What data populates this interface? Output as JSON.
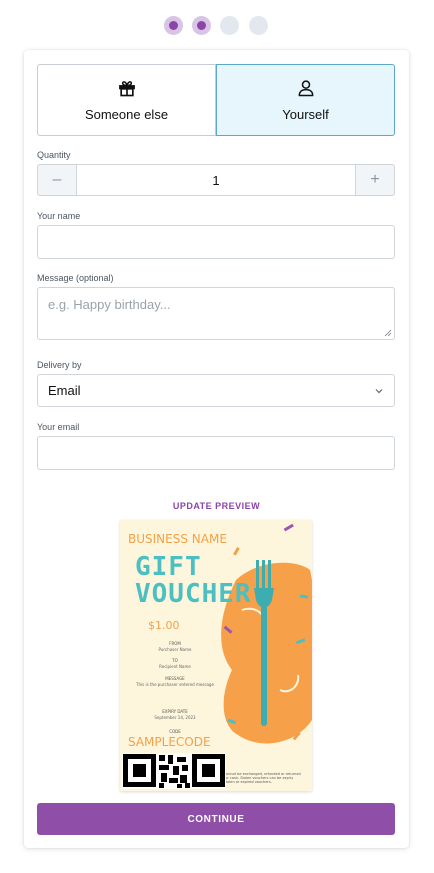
{
  "steps": [
    {
      "state": "done",
      "icon": "step-dot"
    },
    {
      "state": "done",
      "icon": "step-dot"
    },
    {
      "state": "pending",
      "icon": "step-dot"
    },
    {
      "state": "pending",
      "icon": "step-dot"
    }
  ],
  "recipient": {
    "someone_else": {
      "label": "Someone else",
      "icon": "gift-icon",
      "selected": false
    },
    "yourself": {
      "label": "Yourself",
      "icon": "user-icon",
      "selected": true
    }
  },
  "quantity": {
    "label": "Quantity",
    "value": "1",
    "decrement_icon": "minus-icon",
    "increment_icon": "plus-icon"
  },
  "your_name": {
    "label": "Your name",
    "value": ""
  },
  "message": {
    "label": "Message (optional)",
    "placeholder": "e.g. Happy birthday..."
  },
  "delivery": {
    "label": "Delivery by",
    "selected": "Email",
    "icon": "chevron-down-icon"
  },
  "your_email": {
    "label": "Your email",
    "value": ""
  },
  "update_preview": "UPDATE PREVIEW",
  "voucher": {
    "business_name": "BUSINESS NAME",
    "title_line1": "GIFT",
    "title_line2": "VOUCHER",
    "amount": "$1.00",
    "from_label": "FROM",
    "from_value": "Purchaser Name",
    "to_label": "TO",
    "to_value": "Recipient Name",
    "message_label": "MESSAGE",
    "message_value": "This is the purchaser entered message",
    "expiry_label": "EXPIRY DATE",
    "expiry_value": "September 14, 2023",
    "code_label": "CODE",
    "code_value": "SAMPLECODE",
    "fine_print_1": "cannot be exchanged, refunded or returned",
    "fine_print_2": "for cash. Stolen vouchers can be expiry",
    "fine_print_3": "stolen or expired vouchers.",
    "colors": {
      "accent": "#f3a147",
      "teal": "#4bbfc1",
      "background": "#fdf6dd"
    }
  },
  "continue_label": "CONTINUE",
  "colors": {
    "brand": "#8f4fa8",
    "selected_bg": "#e6f6fc",
    "selected_border": "#5ca7cc"
  }
}
